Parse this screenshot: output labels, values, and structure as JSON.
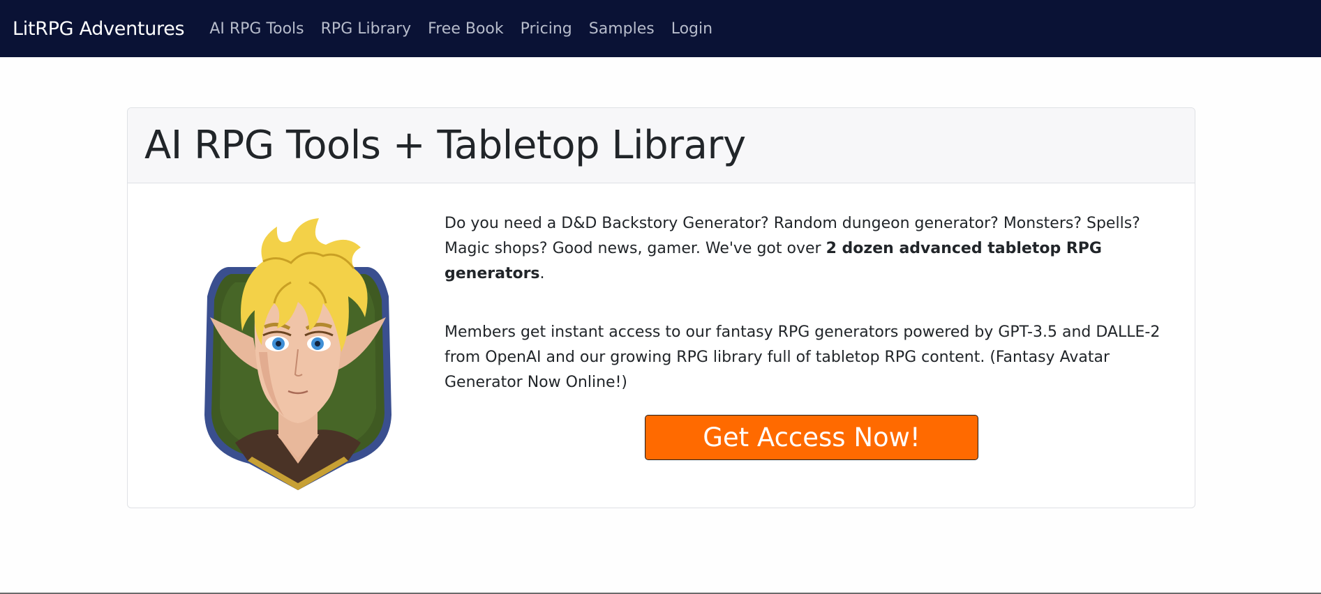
{
  "navbar": {
    "brand": "LitRPG Adventures",
    "links": [
      {
        "label": "AI RPG Tools"
      },
      {
        "label": "RPG Library"
      },
      {
        "label": "Free Book"
      },
      {
        "label": "Pricing"
      },
      {
        "label": "Samples"
      },
      {
        "label": "Login"
      }
    ],
    "background": "#0a1235"
  },
  "hero": {
    "title": "AI RPG Tools + Tabletop Library",
    "image": "elf-avatar-illustration",
    "para1_prefix": "Do you need a D&D Backstory Generator? Random dungeon generator? Monsters? Spells? Magic shops? Good news, gamer. We've got over ",
    "para1_bold": "2 dozen advanced tabletop RPG generators",
    "para1_suffix": ".",
    "para2": "Members get instant access to our fantasy RPG generators powered by GPT-3.5 and DALLE-2 from OpenAI and our growing RPG library full of tabletop RPG content. (Fantasy Avatar Generator Now Online!)",
    "cta_label": "Get Access Now!",
    "cta_color": "#ff6a00"
  }
}
